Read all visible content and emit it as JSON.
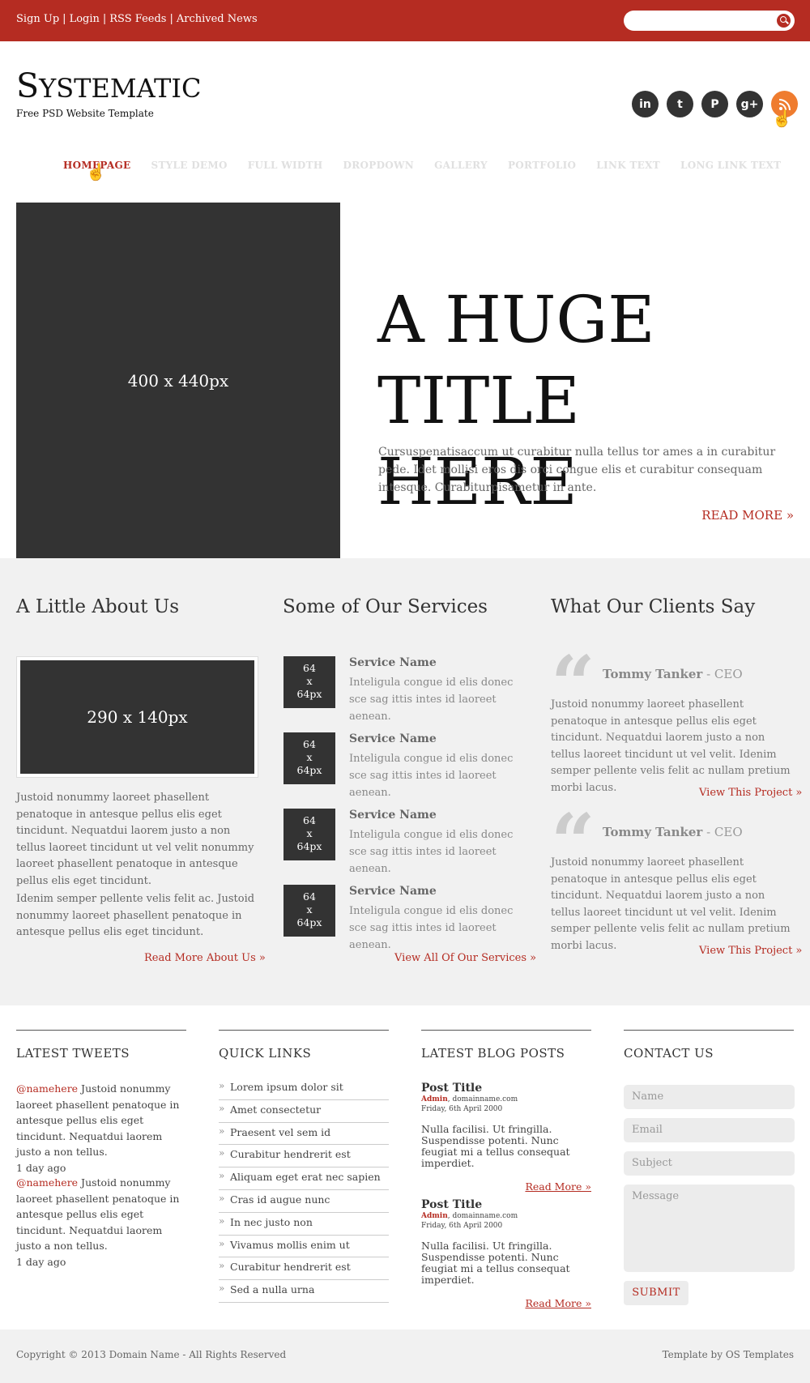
{
  "topbar": {
    "links": [
      "Sign Up",
      "Login",
      "RSS Feeds",
      "Archived News"
    ],
    "search_placeholder": ""
  },
  "branding": {
    "logo_first": "S",
    "logo_rest": "YSTEMATIC",
    "tagline": "Free PSD Website Template"
  },
  "socials": [
    {
      "icon": "linkedin-icon",
      "glyph": "in"
    },
    {
      "icon": "twitter-icon",
      "glyph": "t"
    },
    {
      "icon": "pinterest-icon",
      "glyph": "P"
    },
    {
      "icon": "google-plus-icon",
      "glyph": "g+"
    },
    {
      "icon": "rss-icon",
      "glyph": "))"
    }
  ],
  "nav": [
    "Homepage",
    "Style Demo",
    "Full Width",
    "Dropdown",
    "Gallery",
    "Portfolio",
    "Link Text",
    "Long Link Text"
  ],
  "hero": {
    "image_label": "400 x 440px",
    "title_line1": "A HUGE",
    "title_line2": "TITLE HERE",
    "text": "Cursuspenatisaccum ut curabitur nulla tellus tor ames a in curabitur pede. Idet mollisi eros dis orci congue elis et curabitur consequam intesque. Curabiturpisametur in ante.",
    "more": "READ MORE »"
  },
  "about": {
    "heading": "A Little About Us",
    "image_label": "290 x 140px",
    "p1": "Justoid nonummy laoreet phasellent penatoque in antesque pellus elis eget tincidunt. Nequatdui laorem justo a non tellus laoreet tincidunt ut vel velit nonummy laoreet phasellent penatoque in antesque pellus elis eget tincidunt.",
    "p2": "Idenim semper pellente velis felit ac. Justoid nonummy laoreet phasellent penatoque in antesque pellus elis eget tincidunt.",
    "more": "Read More About Us »"
  },
  "services": {
    "heading": "Some of Our Services",
    "items": [
      {
        "img": "64 x 64px",
        "name": "Service Name",
        "desc": "Inteligula congue id elis donec sce sag ittis intes id laoreet aenean."
      },
      {
        "img": "64 x 64px",
        "name": "Service Name",
        "desc": "Inteligula congue id elis donec sce sag ittis intes id laoreet aenean."
      },
      {
        "img": "64 x 64px",
        "name": "Service Name",
        "desc": "Inteligula congue id elis donec sce sag ittis intes id laoreet aenean."
      },
      {
        "img": "64 x 64px",
        "name": "Service Name",
        "desc": "Inteligula congue id elis donec sce sag ittis intes id laoreet aenean."
      }
    ],
    "more": "View All Of Our Services »"
  },
  "clients": {
    "heading": "What Our Clients Say",
    "items": [
      {
        "name": "Tommy Tanker",
        "role": " - CEO",
        "text": "Justoid nonummy laoreet phasellent penatoque in antesque pellus elis eget tincidunt. Nequatdui laorem justo a non tellus laoreet tincidunt ut vel velit. Idenim semper pellente velis felit ac nullam pretium morbi lacus.",
        "link": "View This Project »"
      },
      {
        "name": "Tommy Tanker",
        "role": " - CEO",
        "text": "Justoid nonummy laoreet phasellent penatoque in antesque pellus elis eget tincidunt. Nequatdui laorem justo a non tellus laoreet tincidunt ut vel velit. Idenim semper pellente velis felit ac nullam pretium morbi lacus.",
        "link": "View This Project »"
      }
    ]
  },
  "tweets": {
    "heading": "Latest Tweets",
    "items": [
      {
        "handle": "@namehere",
        "text": " Justoid nonummy laoreet phasellent penatoque in antesque pellus elis eget tincidunt. Nequatdui laorem justo a non tellus.",
        "time": "1 day ago"
      },
      {
        "handle": "@namehere",
        "text": " Justoid nonummy laoreet phasellent penatoque in antesque pellus elis eget tincidunt. Nequatdui laorem justo a non tellus.",
        "time": "1 day ago"
      }
    ]
  },
  "quick_links": {
    "heading": "Quick Links",
    "items": [
      "Lorem ipsum dolor sit",
      "Amet consectetur",
      "Praesent vel sem id",
      "Curabitur hendrerit est",
      "Aliquam eget erat nec sapien",
      "Cras id augue nunc",
      "In nec justo non",
      "Vivamus mollis enim ut",
      "Curabitur hendrerit est",
      "Sed a nulla urna"
    ]
  },
  "blog": {
    "heading": "Latest Blog Posts",
    "items": [
      {
        "title": "Post Title",
        "author": "Admin",
        "domain": ", domainname.com",
        "date": "Friday, 6th April 2000",
        "text": "Nulla facilisi. Ut fringilla. Suspendisse potenti. Nunc feugiat mi a tellus consequat imperdiet.",
        "more": "Read More »"
      },
      {
        "title": "Post Title",
        "author": "Admin",
        "domain": ", domainname.com",
        "date": "Friday, 6th April 2000",
        "text": "Nulla facilisi. Ut fringilla. Suspendisse potenti. Nunc feugiat mi a tellus consequat imperdiet.",
        "more": "Read More »"
      }
    ]
  },
  "contact": {
    "heading": "Contact Us",
    "name_placeholder": "Name",
    "email_placeholder": "Email",
    "subject_placeholder": "Subject",
    "message_placeholder": "Message",
    "submit": "SUBMIT"
  },
  "footer": {
    "copyright": "Copyright © 2013 Domain Name - All Rights Reserved",
    "credit": "Template by OS Templates"
  },
  "colors": {
    "brand_red": "#b52c22",
    "rss_orange": "#ef7c2f",
    "dark": "#333333",
    "light_gray": "#f1f1f1"
  }
}
